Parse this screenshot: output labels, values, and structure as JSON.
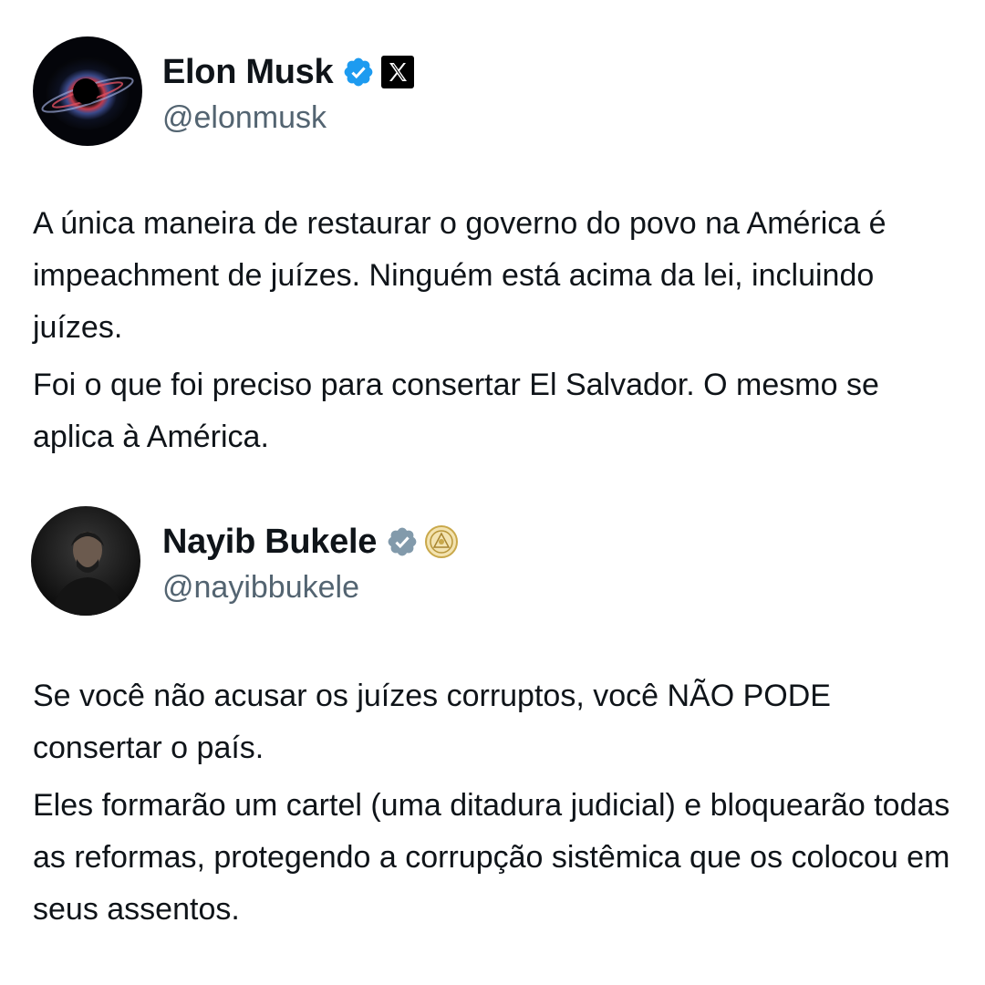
{
  "tweets": [
    {
      "author": {
        "name": "Elon Musk",
        "handle": "@elonmusk",
        "verified_color": "#1d9bf0",
        "affiliation_icon": "x-logo-icon"
      },
      "paragraphs": [
        "A única maneira de restaurar o governo do povo na América é impeachment de juízes. Ninguém está acima da lei, incluindo juízes.",
        "Foi o que foi preciso para consertar El Salvador. O mesmo se aplica à América."
      ]
    },
    {
      "author": {
        "name": "Nayib Bukele",
        "handle": "@nayibbukele",
        "verified_color": "#829aab",
        "affiliation_icon": "el-salvador-seal-icon"
      },
      "paragraphs": [
        "Se você não acusar os juízes corruptos, você NÃO PODE consertar o país.",
        "Eles formarão um cartel (uma ditadura judicial) e bloquearão todas as reformas, protegendo a corrupção sistêmica que os colocou em seus assentos."
      ]
    }
  ]
}
